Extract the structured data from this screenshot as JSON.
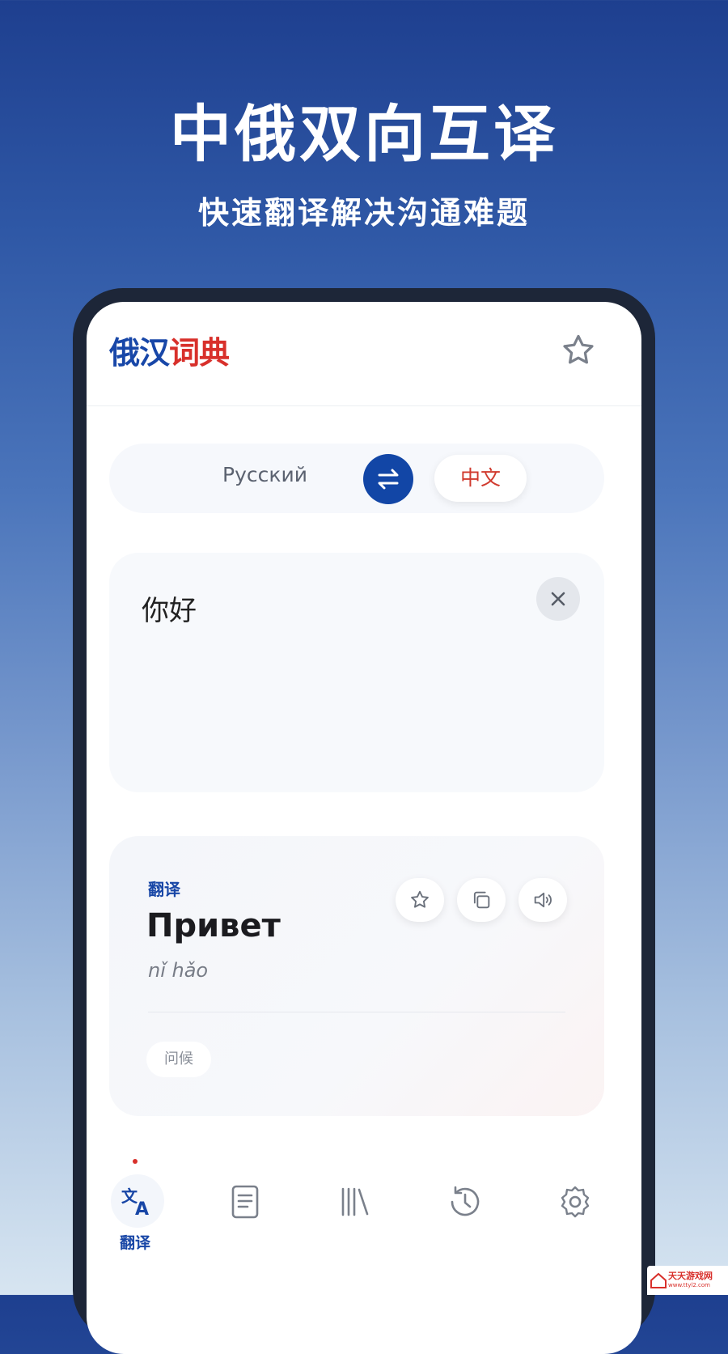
{
  "promo": {
    "headline": "中俄双向互译",
    "subline": "快速翻译解决沟通难题"
  },
  "app": {
    "brand_part1": "俄汉",
    "brand_part2": "词典"
  },
  "language_bar": {
    "source": "Русский",
    "target": "中文"
  },
  "input": {
    "text": "你好"
  },
  "result": {
    "label": "翻译",
    "word": "Привет",
    "pinyin": "nǐ hǎo",
    "tag": "问候"
  },
  "bottom_nav": {
    "items": [
      {
        "id": "translate",
        "label": "翻译",
        "icon": "translate-icon",
        "active": true
      },
      {
        "id": "dictionary",
        "icon": "book-icon"
      },
      {
        "id": "library",
        "icon": "library-icon"
      },
      {
        "id": "history",
        "icon": "history-icon"
      },
      {
        "id": "settings",
        "icon": "gear-icon"
      }
    ]
  },
  "watermark": {
    "text": "天天游戏网",
    "sub": "www.ttyl2.com"
  },
  "colors": {
    "brand_blue": "#1846a6",
    "brand_red": "#d8302b"
  }
}
